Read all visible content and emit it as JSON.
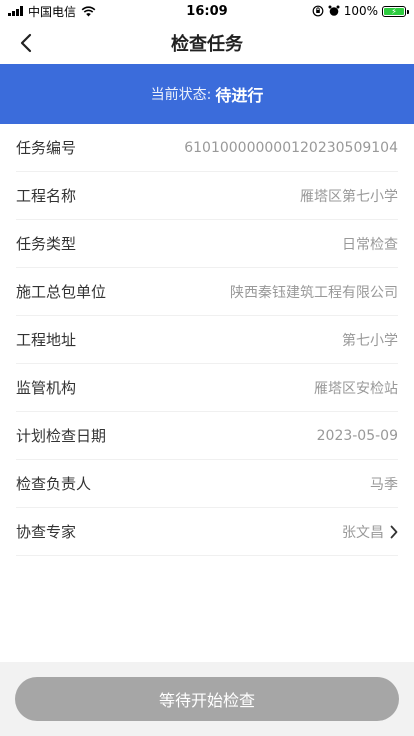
{
  "status_bar": {
    "carrier": "中国电信",
    "time": "16:09",
    "battery": "100%"
  },
  "nav": {
    "title": "检查任务"
  },
  "status": {
    "label": "当前状态:",
    "value": "待进行"
  },
  "rows": [
    {
      "label": "任务编号",
      "value": "6101000000001202305​09104"
    },
    {
      "label": "工程名称",
      "value": "雁塔区第七小学"
    },
    {
      "label": "任务类型",
      "value": "日常检查"
    },
    {
      "label": "施工总包单位",
      "value": "陕西秦钰建筑工程有限公司"
    },
    {
      "label": "工程地址",
      "value": "第七小学"
    },
    {
      "label": "监管机构",
      "value": "雁塔区安检站"
    },
    {
      "label": "计划检查日期",
      "value": "2023-05-09"
    },
    {
      "label": "检查负责人",
      "value": "马季"
    },
    {
      "label": "协查专家",
      "value": "张文昌"
    }
  ],
  "footer": {
    "button_label": "等待开始检查"
  },
  "colors": {
    "accent": "#3b6cdb",
    "button_disabled": "#a6a6a6"
  }
}
